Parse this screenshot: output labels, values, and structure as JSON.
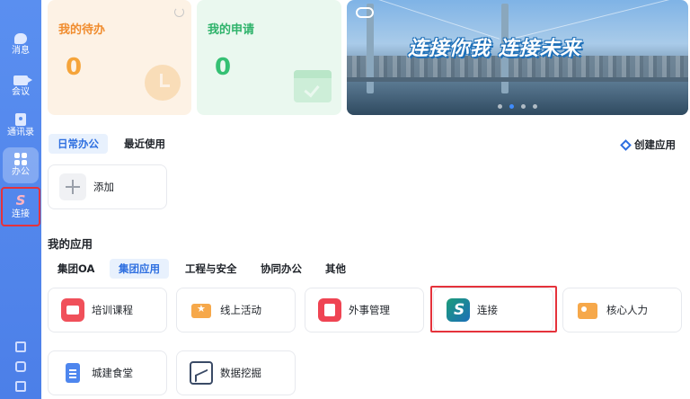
{
  "sidebar": {
    "items": [
      {
        "label": "消息",
        "icon": "message-icon"
      },
      {
        "label": "会议",
        "icon": "meeting-icon"
      },
      {
        "label": "通讯录",
        "icon": "contacts-icon"
      },
      {
        "label": "办公",
        "icon": "office-grid-icon"
      },
      {
        "label": "连接",
        "icon": "connect-icon"
      }
    ],
    "bottom_icons": [
      "calendar-icon",
      "cube-icon",
      "grid-small-icon"
    ]
  },
  "cards": {
    "todo": {
      "title": "我的待办",
      "count": "0"
    },
    "apply": {
      "title": "我的申请",
      "count": "0"
    }
  },
  "banner": {
    "slogan": "连接你我 连接未来",
    "slide_count": 4,
    "active_slide": 2
  },
  "tabs_top": {
    "daily": "日常办公",
    "recent": "最近使用"
  },
  "create_app": "创建应用",
  "add_tile": {
    "label": "添加"
  },
  "my_apps": {
    "title": "我的应用",
    "categories": [
      "集团OA",
      "集团应用",
      "工程与安全",
      "协同办公",
      "其他"
    ],
    "selected_category": "集团应用",
    "apps": [
      {
        "name": "培训课程",
        "icon": "training-course-icon"
      },
      {
        "name": "线上活动",
        "icon": "online-event-icon"
      },
      {
        "name": "外事管理",
        "icon": "foreign-affairs-icon"
      },
      {
        "name": "连接",
        "icon": "connect-app-icon"
      },
      {
        "name": "核心人力",
        "icon": "core-hr-icon"
      },
      {
        "name": "城建食堂",
        "icon": "canteen-icon"
      },
      {
        "name": "数据挖掘",
        "icon": "data-mining-icon"
      }
    ]
  },
  "colors": {
    "sidebar": "#4c7fe8",
    "accent": "#2e6fe0",
    "todo_accent": "#f5a43a",
    "apply_accent": "#35c073",
    "highlight": "#e5323b"
  }
}
